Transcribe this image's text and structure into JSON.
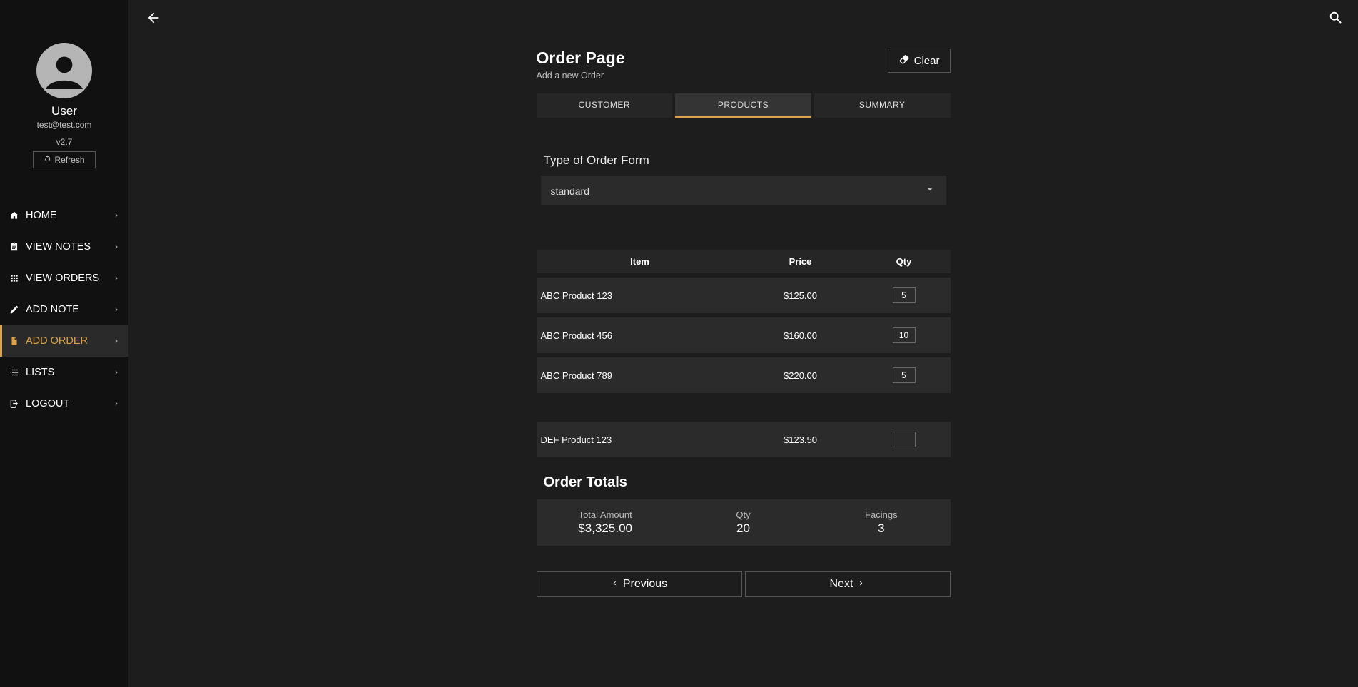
{
  "sidebar": {
    "user_name": "User",
    "user_email": "test@test.com",
    "version": "v2.7",
    "refresh_label": "Refresh",
    "nav": [
      {
        "label": "HOME",
        "icon": "home"
      },
      {
        "label": "VIEW NOTES",
        "icon": "clipboard"
      },
      {
        "label": "VIEW ORDERS",
        "icon": "grid"
      },
      {
        "label": "ADD NOTE",
        "icon": "pencil"
      },
      {
        "label": "ADD ORDER",
        "icon": "file",
        "active": true
      },
      {
        "label": "LISTS",
        "icon": "list"
      },
      {
        "label": "LOGOUT",
        "icon": "logout"
      }
    ]
  },
  "page": {
    "title": "Order Page",
    "subtitle": "Add a new Order",
    "clear_label": "Clear"
  },
  "tabs": {
    "items": [
      "CUSTOMER",
      "PRODUCTS",
      "SUMMARY"
    ],
    "selected": 1
  },
  "order_type": {
    "label": "Type of Order Form",
    "value": "standard"
  },
  "table": {
    "headers": {
      "item": "Item",
      "price": "Price",
      "qty": "Qty"
    },
    "groups": [
      {
        "rows": [
          {
            "name": "ABC Product 123",
            "price": "$125.00",
            "qty": "5"
          },
          {
            "name": "ABC Product 456",
            "price": "$160.00",
            "qty": "10"
          },
          {
            "name": "ABC Product 789",
            "price": "$220.00",
            "qty": "5"
          }
        ]
      },
      {
        "rows": [
          {
            "name": "DEF Product 123",
            "price": "$123.50",
            "qty": ""
          }
        ]
      }
    ]
  },
  "totals": {
    "title": "Order Totals",
    "cols": [
      {
        "label": "Total Amount",
        "value": "$3,325.00"
      },
      {
        "label": "Qty",
        "value": "20"
      },
      {
        "label": "Facings",
        "value": "3"
      }
    ]
  },
  "footer": {
    "prev": "Previous",
    "next": "Next"
  }
}
